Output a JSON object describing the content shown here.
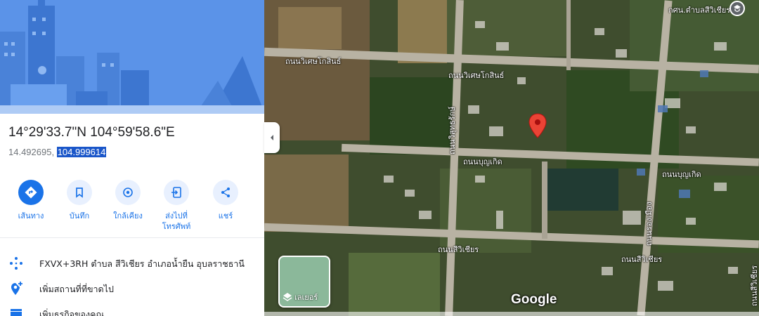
{
  "coordinates": {
    "dms": "14°29'33.7\"N 104°59'58.6\"E",
    "lat_decimal": "14.492695, ",
    "lng_decimal": "104.999614"
  },
  "actions": [
    {
      "label": "เส้นทาง",
      "icon": "directions-icon"
    },
    {
      "label": "บันทึก",
      "icon": "bookmark-icon"
    },
    {
      "label": "ใกล้เคียง",
      "icon": "nearby-icon"
    },
    {
      "label_line1": "ส่งไปที่",
      "label_line2": "โทรศัพท์",
      "icon": "send-to-phone-icon"
    },
    {
      "label": "แชร์",
      "icon": "share-icon"
    }
  ],
  "info_rows": [
    {
      "text": "FXVX+3RH ตำบล สีวิเชียร อำเภอน้ำยืน อุบลราชธานี",
      "icon": "plus-code-icon"
    },
    {
      "text": "เพิ่มสถานที่ที่ขาดไป",
      "icon": "add-place-icon"
    },
    {
      "text": "เพิ่มธุรกิจของคุณ",
      "icon": "business-icon"
    }
  ],
  "map": {
    "road_labels": [
      "ถนนวิเศษโกสินธ์",
      "ถนนวิเศษโกสินธ์",
      "ถนนวิสุทธรักษ์",
      "ถนนบุญเกิด",
      "ถนนบุญเกิด",
      "ถนนสีวิเชียร",
      "ถนนสีวิเชียร",
      "ถนนสีวิเชียร",
      "ถนนรองเมือง"
    ],
    "place_label": "กศน.ตำบลสีวิเชียร",
    "layers_label": "เลเยอร์",
    "logo_text": "Google"
  },
  "colors": {
    "accent": "#1a73e8",
    "hero_bg": "#5b93e8",
    "pin": "#ea4335"
  }
}
